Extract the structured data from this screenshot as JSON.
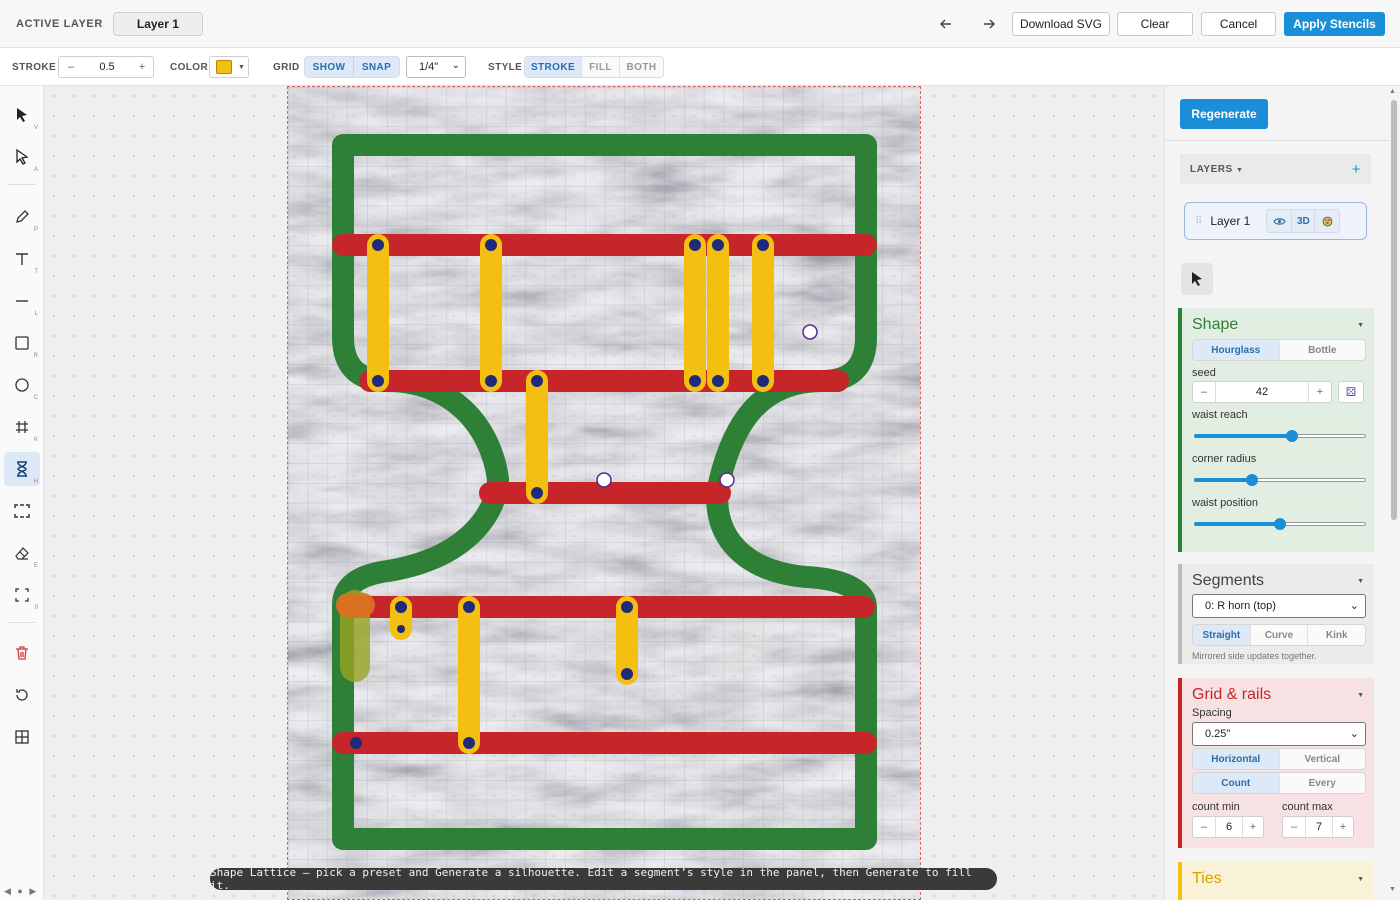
{
  "header": {
    "active_layer_label": "ACTIVE LAYER",
    "active_layer_value": "Layer 1",
    "undo_icon": "arrow-left-icon",
    "redo_icon": "arrow-right-icon",
    "download_label": "Download SVG",
    "clear_label": "Clear",
    "cancel_label": "Cancel",
    "apply_label": "Apply Stencils"
  },
  "toolbar": {
    "stroke_label": "STROKE",
    "stroke_value": "0.5",
    "minus": "–",
    "plus": "+",
    "color_label": "COLOR",
    "color_value": "#f5bf12",
    "grid_label": "GRID",
    "grid_show": "SHOW",
    "grid_snap": "SNAP",
    "grid_size": "1/4\"",
    "style_label": "STYLE",
    "style_options": [
      "STROKE",
      "FILL",
      "BOTH"
    ],
    "style_selected": "STROKE"
  },
  "tools": [
    {
      "name": "select-tool",
      "key": "V",
      "icon": "cursor-arrow-icon"
    },
    {
      "name": "direct-select-tool",
      "key": "A",
      "icon": "direct-select-icon"
    },
    {
      "name": "pen-tool",
      "key": "P",
      "icon": "pen-icon"
    },
    {
      "name": "text-tool",
      "key": "T",
      "icon": "text-icon"
    },
    {
      "name": "line-tool",
      "key": "L",
      "icon": "line-icon"
    },
    {
      "name": "rectangle-tool",
      "key": "R",
      "icon": "square-icon"
    },
    {
      "name": "ellipse-tool",
      "key": "C",
      "icon": "circle-icon"
    },
    {
      "name": "grid-tool",
      "key": "K",
      "icon": "hash-icon"
    },
    {
      "name": "hourglass-tool",
      "key": "H",
      "icon": "hourglass-icon",
      "active": true
    },
    {
      "name": "frame-tool",
      "key": "",
      "icon": "frame-icon"
    },
    {
      "name": "eraser-tool",
      "key": "E",
      "icon": "eraser-icon"
    },
    {
      "name": "fit-tool",
      "key": "0",
      "icon": "fit-screen-icon"
    },
    {
      "name": "delete-tool",
      "key": "",
      "icon": "trash-icon"
    },
    {
      "name": "reset-tool",
      "key": "",
      "icon": "rotate-icon"
    },
    {
      "name": "layout-tool",
      "key": "",
      "icon": "grid-squares-icon"
    }
  ],
  "canvas": {
    "hint": "Shape Lattice — pick a preset and Generate a silhouette. Edit a segment’s style in the panel, then Generate to fill it.",
    "colors": {
      "frame": "#2e8036",
      "rail": "#c6262a",
      "tie": "#f5bf12",
      "dot": "#1f2a7a"
    }
  },
  "panel": {
    "regenerate_label": "Regenerate",
    "layers_label": "LAYERS",
    "add_layer": "+",
    "layer_name": "Layer 1",
    "layer_3d": "3D",
    "shape": {
      "title": "Shape",
      "presets": [
        "Hourglass",
        "Bottle"
      ],
      "preset_selected": "Hourglass",
      "seed_label": "seed",
      "seed_value": "42",
      "waist_reach_label": "waist reach",
      "waist_reach": 0.57,
      "corner_radius_label": "corner radius",
      "corner_radius": 0.34,
      "waist_position_label": "waist position",
      "waist_position": 0.5
    },
    "segments": {
      "title": "Segments",
      "selected": "0: R horn (top)",
      "styles": [
        "Straight",
        "Curve",
        "Kink"
      ],
      "style_selected": "Straight",
      "note": "Mirrored side updates together."
    },
    "grid_rails": {
      "title": "Grid & rails",
      "spacing_label": "Spacing",
      "spacing_value": "0.25\"",
      "orientation": [
        "Horizontal",
        "Vertical"
      ],
      "orientation_selected": "Horizontal",
      "mode": [
        "Count",
        "Every"
      ],
      "mode_selected": "Count",
      "count_min_label": "count min",
      "count_min": "6",
      "count_max_label": "count max",
      "count_max": "7"
    },
    "ties": {
      "title": "Ties"
    }
  }
}
